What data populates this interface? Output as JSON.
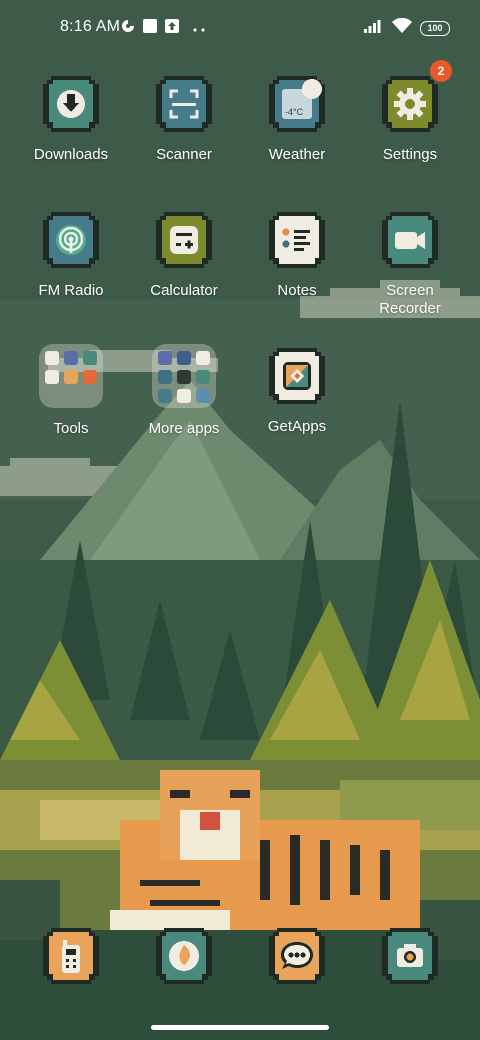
{
  "status_bar": {
    "time": "8:16 AM",
    "left_icons": [
      "data-saver-icon",
      "square-notification-icon",
      "upload-icon",
      "more-dots-icon"
    ],
    "battery": "100",
    "right_icons": [
      "signal-icon",
      "wifi-icon",
      "battery-icon"
    ]
  },
  "apps": [
    {
      "label": "Downloads",
      "icon": "download-icon"
    },
    {
      "label": "Scanner",
      "icon": "scanner-icon"
    },
    {
      "label": "Weather",
      "icon": "weather-icon",
      "icon_text": "-4°C"
    },
    {
      "label": "Settings",
      "icon": "gear-icon",
      "badge": "2"
    },
    {
      "label": "FM Radio",
      "icon": "radio-icon"
    },
    {
      "label": "Calculator",
      "icon": "calculator-icon"
    },
    {
      "label": "Notes",
      "icon": "notes-icon"
    },
    {
      "label": "Screen Recorder",
      "icon": "video-camera-icon"
    },
    {
      "label": "Tools",
      "icon": "folder-icon"
    },
    {
      "label": "More apps",
      "icon": "folder-icon"
    },
    {
      "label": "GetApps",
      "icon": "getapps-icon"
    }
  ],
  "dock": [
    {
      "icon": "walkie-talkie-icon"
    },
    {
      "icon": "browser-icon"
    },
    {
      "icon": "messages-icon"
    },
    {
      "icon": "camera-icon"
    }
  ],
  "colors": {
    "teal": "#4a8a7c",
    "steel": "#457b8a",
    "olive": "#7d8b2d",
    "cream": "#f1ece1",
    "orange": "#e9a35b",
    "badge": "#e8582a"
  }
}
